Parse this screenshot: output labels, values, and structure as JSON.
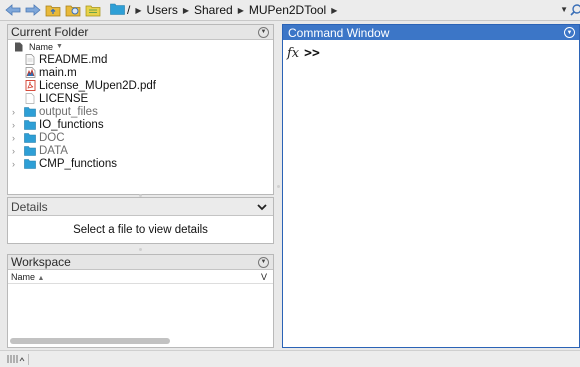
{
  "path_bar": {
    "crumbs": [
      "/",
      "Users",
      "Shared",
      "MUPen2DTool"
    ],
    "separator_icon": "triangle-right-icon"
  },
  "current_folder": {
    "title": "Current Folder",
    "column_name": "Name",
    "sort_icon": "sort-desc-icon",
    "files": [
      {
        "name": "README.md",
        "icon": "text-file-icon",
        "expandable": false,
        "dim": false
      },
      {
        "name": "main.m",
        "icon": "m-file-icon",
        "expandable": false,
        "dim": false
      },
      {
        "name": "License_MUpen2D.pdf",
        "icon": "pdf-file-icon",
        "expandable": false,
        "dim": false
      },
      {
        "name": "LICENSE",
        "icon": "blank-file-icon",
        "expandable": false,
        "dim": false
      },
      {
        "name": "output_files",
        "icon": "folder-icon",
        "expandable": true,
        "dim": true
      },
      {
        "name": "IO_functions",
        "icon": "folder-icon",
        "expandable": true,
        "dim": false
      },
      {
        "name": "DOC",
        "icon": "folder-icon",
        "expandable": true,
        "dim": true
      },
      {
        "name": "DATA",
        "icon": "folder-icon",
        "expandable": true,
        "dim": true
      },
      {
        "name": "CMP_functions",
        "icon": "folder-icon",
        "expandable": true,
        "dim": false
      }
    ]
  },
  "details": {
    "title": "Details",
    "message": "Select a file to view details"
  },
  "workspace": {
    "title": "Workspace",
    "column_name": "Name",
    "column_value": "V"
  },
  "command_window": {
    "title": "Command Window",
    "fx": "fx",
    "prompt": ">>"
  },
  "colors": {
    "accent": "#3c76c7",
    "folder": "#2e9fd6",
    "pdf": "#d23a2a"
  }
}
